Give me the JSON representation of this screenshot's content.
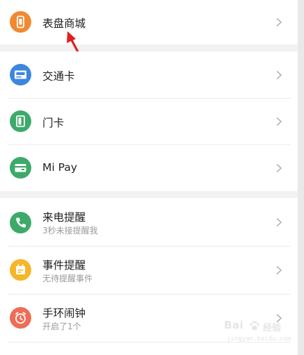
{
  "sections": {
    "watch_store": {
      "title": "表盘商城"
    },
    "cards": [
      {
        "title": "交通卡",
        "icon": "bus-card-icon",
        "icon_color": "#3d86de"
      },
      {
        "title": "门卡",
        "icon": "door-card-icon",
        "icon_color": "#3daa6a"
      },
      {
        "title": "Mi Pay",
        "icon": "wallet-icon",
        "icon_color": "#3daa6a"
      }
    ],
    "notifications": [
      {
        "title": "来电提醒",
        "subtitle": "3秒未接提醒我",
        "icon": "phone-icon",
        "icon_color": "#3daa6a"
      },
      {
        "title": "事件提醒",
        "subtitle": "无待提醒事件",
        "icon": "calendar-icon",
        "icon_color": "#f5b629"
      },
      {
        "title": "手环闹钟",
        "subtitle": "开启了1个",
        "icon": "alarm-clock-icon",
        "icon_color": "#ef6d57"
      }
    ]
  },
  "watch_store_icon": {
    "icon": "watch-icon",
    "icon_color": "#f08a32"
  },
  "annotation": {
    "icon": "red-arrow-icon",
    "color": "#e02020"
  },
  "watermark": {
    "brand": "Bai",
    "brand_suffix": "经验",
    "url": "jingyan.baidu.com"
  }
}
